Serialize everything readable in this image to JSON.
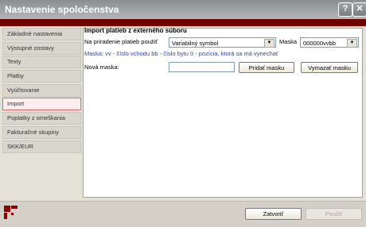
{
  "window": {
    "title": "Nastavenie spoločenstva"
  },
  "titlebar_buttons": {
    "help": "?",
    "close": "✕"
  },
  "sidebar": {
    "items": [
      {
        "label": "Základné nastavenia"
      },
      {
        "label": "Výstupné zostavy"
      },
      {
        "label": "Texty"
      },
      {
        "label": "Platby"
      },
      {
        "label": "Vyúčtovanie"
      },
      {
        "label": "Import"
      },
      {
        "label": "Poplatky z omeškania"
      },
      {
        "label": "Fakturačné skupiny"
      },
      {
        "label": "SKK/EUR"
      }
    ],
    "active_index": 5
  },
  "main": {
    "section_title": "Import platieb z externého súboru",
    "assign_label": "Na priradenie platieb použiť",
    "assign_value": "Variabilný symbol",
    "mask_label": "Maska",
    "mask_value": "000000vvbb",
    "hint": "Maska: vv - číslo vchodu    bb - číslo bytu    0 - pozícia, ktorá sa má vynechať",
    "new_mask_label": "Nová maska:",
    "new_mask_value": "",
    "add_mask_button": "Pridať masku",
    "delete_mask_button": "Vymazať masku"
  },
  "footer": {
    "close_button": "Zatvoriť",
    "apply_button": "Použiť"
  },
  "colors": {
    "accent": "#6e0000",
    "active_nav_border": "#d66a6a"
  }
}
